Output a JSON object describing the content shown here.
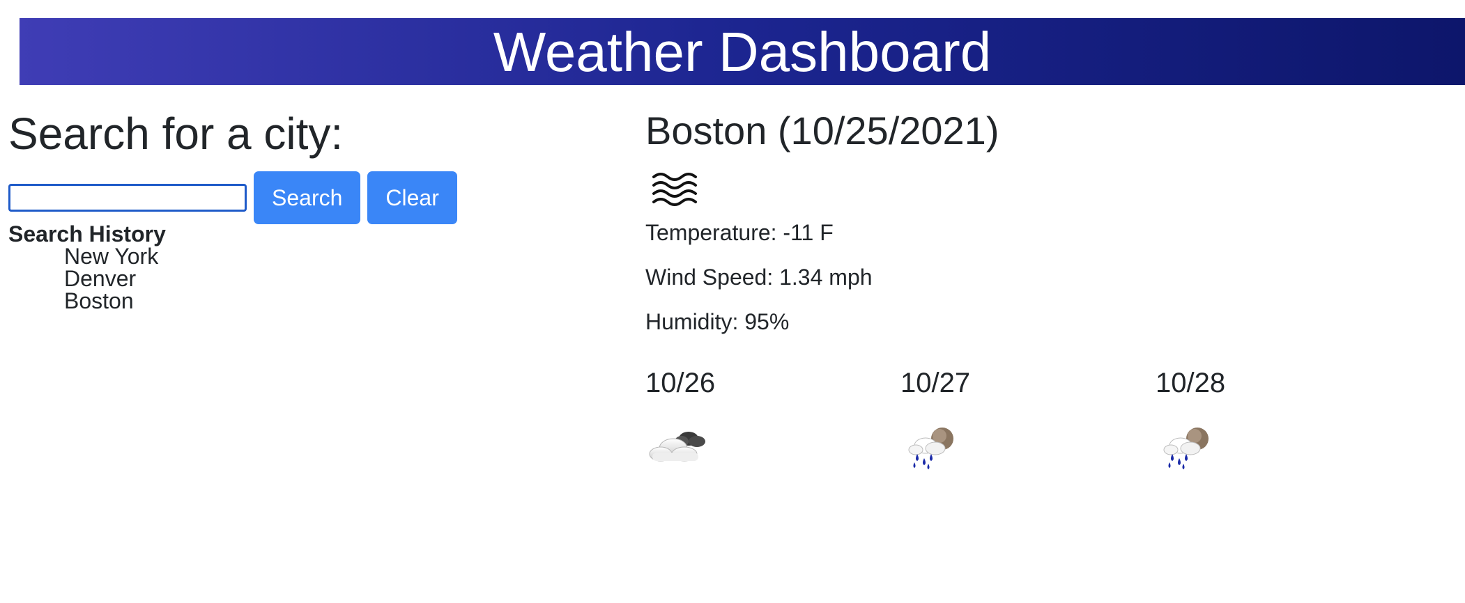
{
  "header": {
    "title": "Weather Dashboard"
  },
  "search": {
    "heading": "Search for a city:",
    "input_value": "",
    "placeholder": "",
    "search_label": "Search",
    "clear_label": "Clear",
    "history_title": "Search History",
    "history": [
      {
        "label": "New York"
      },
      {
        "label": "Denver"
      },
      {
        "label": "Boston"
      }
    ]
  },
  "current": {
    "title": "Boston (10/25/2021)",
    "icon": "mist-icon",
    "temperature": "Temperature: -11 F",
    "wind": "Wind Speed: 1.34 mph",
    "humidity": "Humidity: 95%"
  },
  "forecast": [
    {
      "date": "10/26",
      "icon": "cloudy-icon"
    },
    {
      "date": "10/27",
      "icon": "rain-icon"
    },
    {
      "date": "10/28",
      "icon": "rain-icon"
    }
  ],
  "colors": {
    "header_start": "#3f3db5",
    "header_end": "#0d166b",
    "button": "#3a86f7",
    "rain_drop": "#1a2aa8"
  }
}
